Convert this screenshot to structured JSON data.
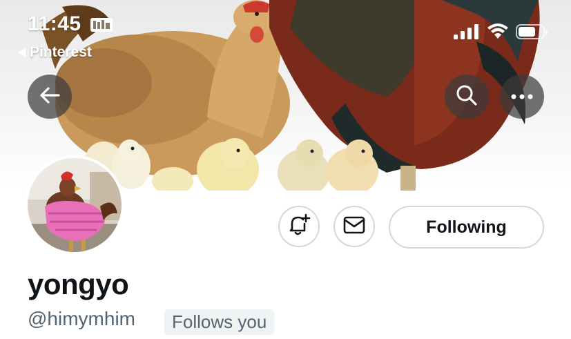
{
  "status_bar": {
    "time": "11:45",
    "back_app": "Pinterest",
    "icons": [
      "id-card-icon",
      "signal-bars-icon",
      "wifi-icon",
      "battery-icon"
    ]
  },
  "header": {
    "back_icon": "arrow-left-icon",
    "search_icon": "search-icon",
    "more_icon": "more-dots-icon"
  },
  "actions": {
    "notify_icon": "bell-plus-icon",
    "message_icon": "envelope-icon",
    "following_label": "Following"
  },
  "profile": {
    "display_name": "yongyo",
    "handle": "@himymhim",
    "follows_you": "Follows you"
  },
  "colors": {
    "text_primary": "#0f1419",
    "text_secondary": "#536471",
    "button_border": "#cfd9de",
    "badge_bg": "#eff3f4",
    "overlay_button": "#3c3c3c"
  }
}
